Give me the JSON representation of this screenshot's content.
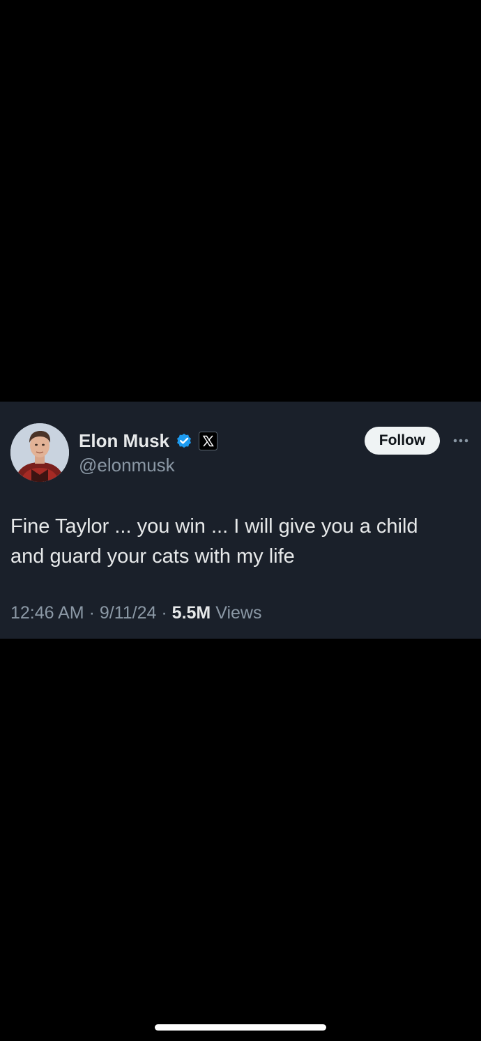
{
  "tweet": {
    "author": {
      "display_name": "Elon Musk",
      "handle": "@elonmusk",
      "verified_badge_icon": "verified-checkmark-icon",
      "affiliate_icon": "x-logo-icon"
    },
    "follow_label": "Follow",
    "more_icon": "more-options-icon",
    "text_lines": [
      "Fine Taylor ... you win ... I will give you a child",
      "and guard your cats with my life"
    ],
    "meta": {
      "time": "12:46 AM",
      "separator": "·",
      "date": "9/11/24",
      "views_count": "5.5M",
      "views_label": "Views"
    }
  },
  "colors": {
    "page_background": "#000000",
    "card_background": "#1a202a",
    "primary_text": "#e7e9ea",
    "secondary_text": "#8b98a5",
    "verified_blue": "#1d9bf0",
    "follow_button_bg": "#eff3f4"
  }
}
